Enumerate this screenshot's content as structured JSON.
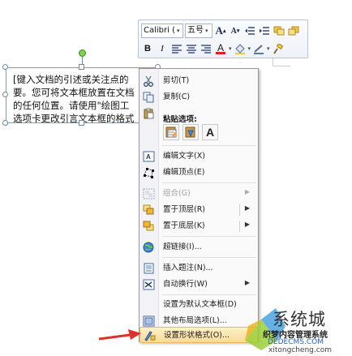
{
  "mini_toolbar": {
    "font_name": "Calibri (",
    "font_size": "五号",
    "grow_font": "A",
    "shrink_font": "A",
    "bold": "B",
    "italic": "I",
    "font_color_label": "A"
  },
  "text_box": {
    "lines": [
      "[键入文档的引述或关注点的",
      "要。您可将文本框放置在文档",
      "的任何位置。请使用\"绘图工",
      "选项卡更改引言文本框的格式"
    ]
  },
  "context_menu": {
    "cut": "剪切(T)",
    "copy": "复制(C)",
    "paste_options": "粘贴选项:",
    "paste_text_only": "A",
    "edit_text": "编辑文字(X)",
    "edit_points": "编辑顶点(E)",
    "group": "组合(G)",
    "bring_to_front": "置于顶层(R)",
    "send_to_back": "置于底层(K)",
    "hyperlink": "超链接(I)...",
    "insert_caption": "插入题注(N)...",
    "wrap_text": "自动换行(W)",
    "set_default_textbox": "设置为默认文本框(D)",
    "more_layout": "其他布局选项(L)...",
    "format_shape": "设置形状格式(O)..."
  },
  "watermark": {
    "brand": "系统城",
    "subtitle": "织梦内容管理系统",
    "url": "DEDECMS.COM",
    "url2": "xitongcheng.com"
  },
  "colors": {
    "menu_hover": "#fcd99a",
    "arrow_red": "#e0302a",
    "font_color_red": "#e02020"
  }
}
